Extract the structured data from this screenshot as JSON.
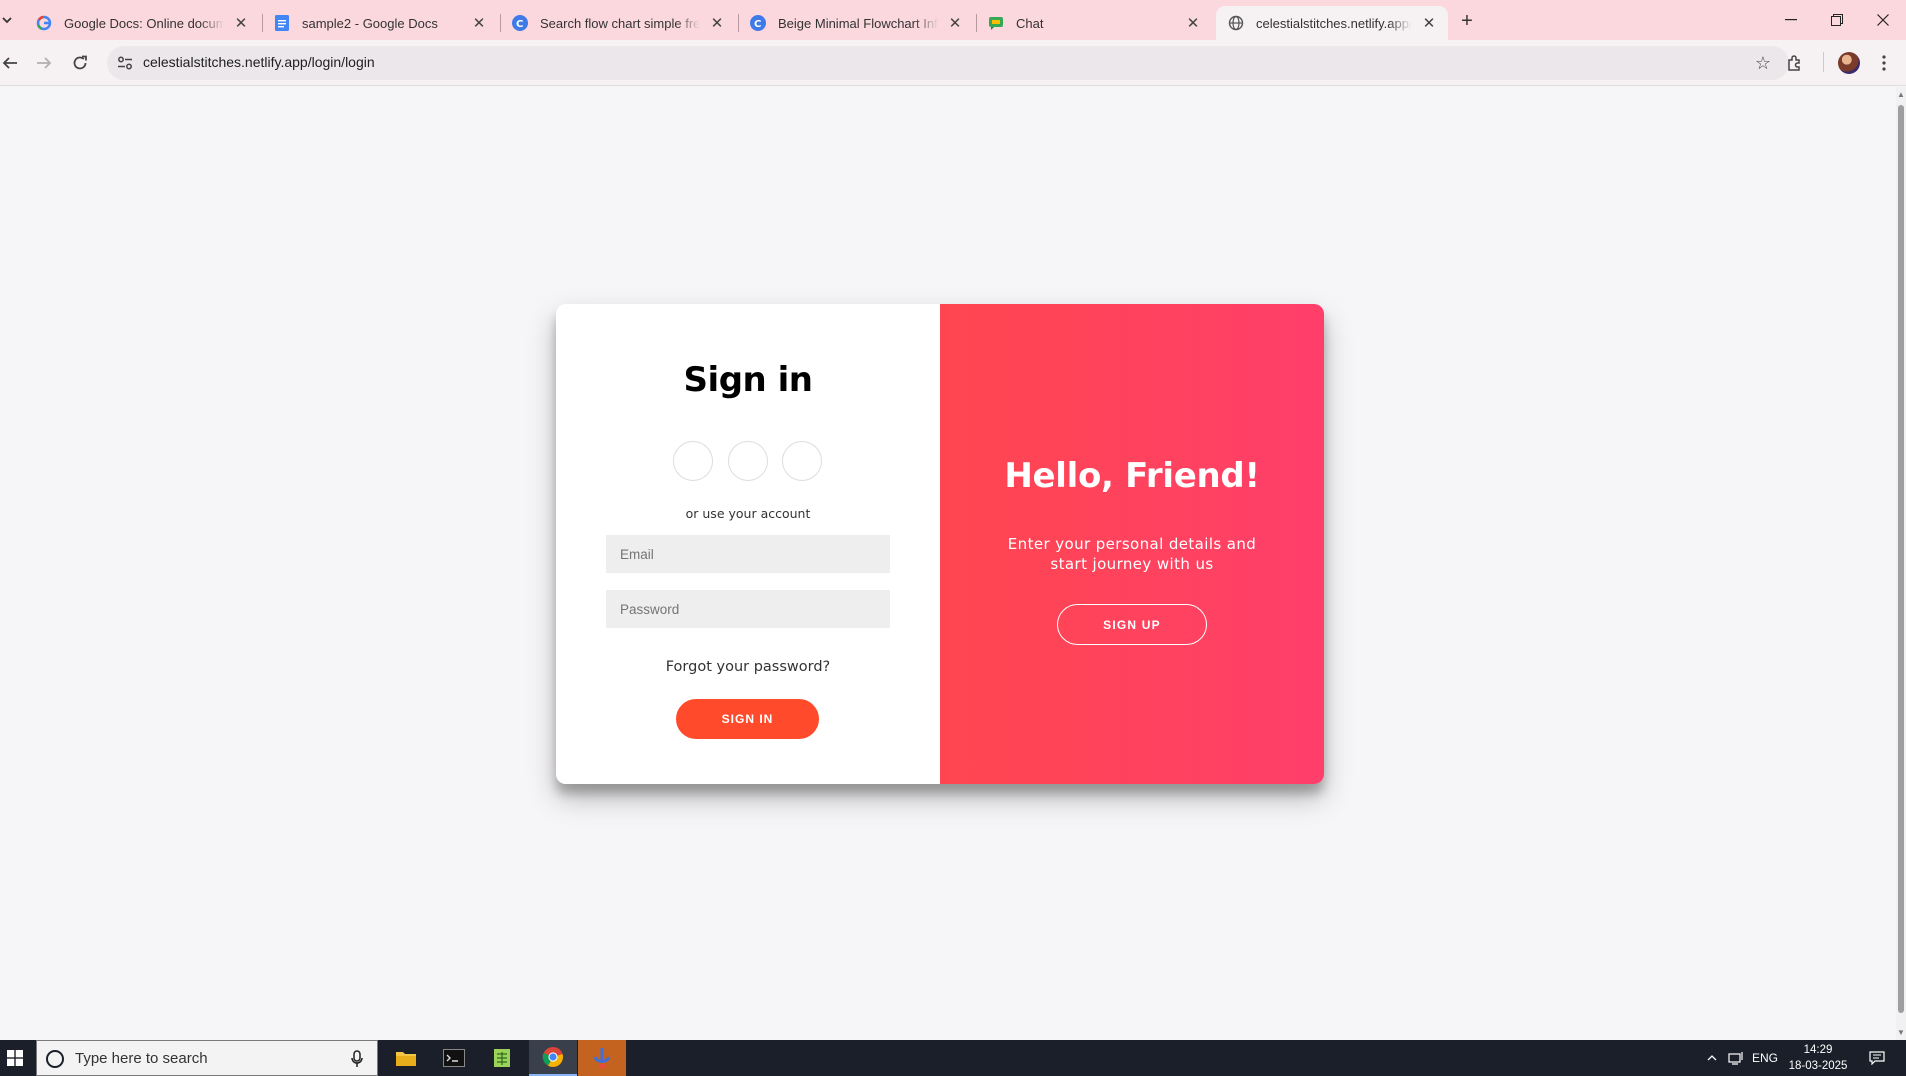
{
  "browser": {
    "tabs": [
      {
        "title": "Google Docs: Online document",
        "favicon": "google-g-icon",
        "active": false
      },
      {
        "title": "sample2 - Google Docs",
        "favicon": "google-docs-icon",
        "active": false
      },
      {
        "title": "Search flow chart simple free - C",
        "favicon": "canva-icon",
        "active": false
      },
      {
        "title": "Beige Minimal Flowchart Infogra",
        "favicon": "canva-icon",
        "active": false
      },
      {
        "title": "Chat",
        "favicon": "google-chat-icon",
        "active": false
      },
      {
        "title": "celestialstitches.netlify.app/logi",
        "favicon": "globe-icon",
        "active": true
      }
    ],
    "url": "celestialstitches.netlify.app/login/login"
  },
  "signin": {
    "title": "Sign in",
    "alt_text": "or use your account",
    "email_placeholder": "Email",
    "password_placeholder": "Password",
    "forgot": "Forgot your password?",
    "button": "SIGN IN"
  },
  "overlay": {
    "title": "Hello, Friend!",
    "text": "Enter your personal details and start journey with us",
    "button": "SIGN UP"
  },
  "taskbar": {
    "search_placeholder": "Type here to search",
    "language": "ENG",
    "time": "14:29",
    "date": "18-03-2025"
  },
  "colors": {
    "signin_button": "#ff4b2b",
    "overlay_gradient_start": "#ff4650",
    "overlay_gradient_end": "#ff3f6a",
    "tabstrip": "#fbd7de"
  }
}
